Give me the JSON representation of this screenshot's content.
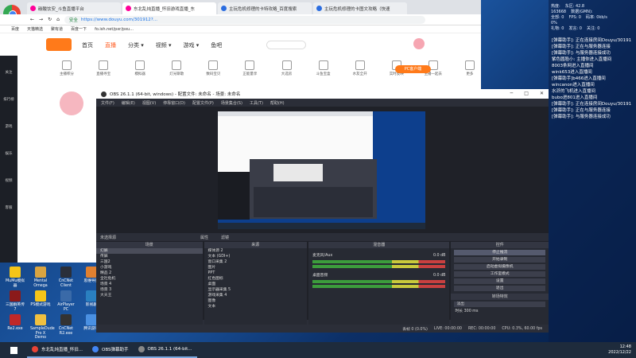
{
  "browser": {
    "tabs": [
      "碳酸饮安_斗鱼直播平台",
      "东北乱炖直播_怀旧游戏直播_东",
      "主玩危机修理的卡特攻略_百度搜索",
      "主玩危机修理的卡图文攻略（快速"
    ],
    "url": "https://www.douyu.com/301912?...",
    "secure_label": "安全",
    "bookmarks": [
      "百度",
      "天猫精选",
      "聚有道",
      "百度一下",
      "fo.ish.net/pxr/pxu..."
    ],
    "nav": [
      "首页",
      "直播",
      "分类 ▾",
      "视频 ▾",
      "游戏 ▾",
      "鱼吧"
    ],
    "nav_active": "直播",
    "sub_items": [
      "主播积分",
      "直播寻宝",
      "模拟器",
      "灯光聊歌",
      "数码宝贝",
      "正能量享",
      "大选房",
      "斗鱼宝盒",
      "水友全开",
      "实时反映",
      "主播一起去",
      "更多"
    ],
    "pc_btn": "PC客户端",
    "sidebar": [
      "关注",
      "排行榜",
      "游戏",
      "娱乐",
      "视频",
      "客服"
    ]
  },
  "obs": {
    "title": "OBS 26.1.1 (64-bit, windows) - 配置文件: 未命名 - 场景: 未命名",
    "menu": [
      "文件(F)",
      "编辑(E)",
      "视图(V)",
      "停靠窗口(D)",
      "配置文件(P)",
      "场景集合(S)",
      "工具(T)",
      "帮助(H)"
    ],
    "source_bar": [
      "未选择源",
      "属性",
      "滤镜"
    ],
    "scenes_title": "场景",
    "scenes": [
      "幻屏",
      "传屏",
      "三国2",
      "小游戏",
      "精品 2",
      "全社危机",
      "场景 4",
      "场景 3",
      "大天王"
    ],
    "sources_title": "来源",
    "sources": [
      "媒体源 2",
      "文本 (GDI+)",
      "窗口采集 2",
      "图片",
      "PPT",
      "红色图标",
      "桌面",
      "显示器采集 5",
      "游戏采集 4",
      "图像",
      "文本"
    ],
    "mixer_title": "混音器",
    "mixer": [
      {
        "name": "麦克风/Aux",
        "db": "0.0 dB"
      },
      {
        "name": "桌面音频",
        "db": "0.0 dB"
      }
    ],
    "controls_title": "控件",
    "controls": [
      "停止推流",
      "开始录制",
      "启动虚拟摄像机",
      "工作室模式",
      "设置",
      "退出"
    ],
    "transition_title": "转场特效",
    "transition": "淡出",
    "duration_label": "时长",
    "duration": "300 ms",
    "status": [
      "丢帧 0 (0.0%)",
      "LIVE: 00:00:00",
      "REC: 00:00:00",
      "CPU: 0.3%, 60.00 fps"
    ]
  },
  "rpanel": {
    "stats": [
      [
        "热度:",
        "东区: 42.8"
      ],
      [
        "163668",
        "数据(GMN):"
      ],
      [
        "全部: 0",
        "FPS: 0",
        "码率: 0kb/s"
      ],
      [
        "0%",
        "",
        ""
      ],
      [
        "礼物: 0",
        "发言: 0",
        "关注: 0"
      ]
    ],
    "chat": [
      "[弹幕助手]: 正在连接房间Douyu/30191",
      "[弹幕助手]: 正在与服务器连接",
      "[弹幕助手]: 与服务器连接成功",
      "紫色圆脸小: 主播你进入直播间",
      "8003条网进入直播间",
      "wink653进入直播间",
      "[弹幕助手]b466进入直播间",
      "wincanon进入直播间",
      "水浒的飞机进入直播间",
      "bubo进801进入直播间",
      "[弹幕助手]: 正在连接房间Douyu/30191",
      "[弹幕助手]: 正在与服务器连接",
      "[弹幕助手]: 与服务器连接成功"
    ]
  },
  "desktop": [
    "MuMu模拟器",
    "Mental Omega",
    "CnCNet Client",
    "思维导图",
    "三国群英传7",
    "PS模式游戏",
    "AirPlayer PC",
    "影视剧",
    "Re2.exe",
    "SampleDude Pro X Demo",
    "CnCNet R2.exe",
    "腾讯游戏"
  ],
  "taskbar": {
    "items": [
      "东北乱炖直播_怀旧...",
      "OBS弹幕助手",
      "OBS 26.1.1 (64-bit..."
    ],
    "time": "12:48",
    "date": "2022/12/22"
  }
}
